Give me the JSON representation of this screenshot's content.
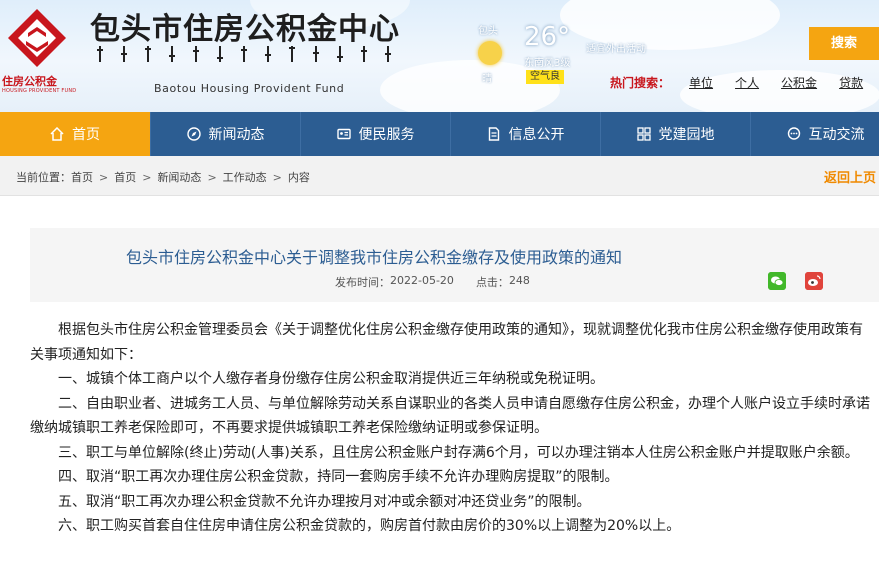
{
  "header": {
    "site_title": "包头市住房公积金中心",
    "site_title_en": "Baotou Housing Provident Fund",
    "logo_caption": "住房公积金",
    "logo_caption_en": "HOUSING PROVIDENT FUND"
  },
  "weather": {
    "city": "包头",
    "temperature": "26°",
    "condition": "晴",
    "wind": "东南风3级",
    "description": "适宜外出活动",
    "aqi": "空气良"
  },
  "search": {
    "placeholder": "",
    "button_label": "搜索",
    "hot_label": "热门搜索：",
    "hot_terms": [
      "单位",
      "个人",
      "公积金",
      "贷款"
    ]
  },
  "nav": {
    "items": [
      {
        "label": "首页",
        "icon": "home-icon"
      },
      {
        "label": "新闻动态",
        "icon": "compass-icon"
      },
      {
        "label": "便民服务",
        "icon": "id-card-icon"
      },
      {
        "label": "信息公开",
        "icon": "document-icon"
      },
      {
        "label": "党建园地",
        "icon": "grid-icon"
      },
      {
        "label": "互动交流",
        "icon": "chat-icon"
      }
    ],
    "active_color": "#f5a511",
    "bar_color": "#2c5d92"
  },
  "breadcrumb": {
    "label": "当前位置：",
    "items": [
      "首页",
      "首页",
      "新闻动态",
      "工作动态",
      "内容"
    ],
    "back_label": "返回上页"
  },
  "article": {
    "title": "包头市住房公积金中心关于调整我市住房公积金缴存及使用政策的通知",
    "date_label": "发布时间：",
    "date": "2022-05-20",
    "views_label": "点击：",
    "views": "248",
    "paragraphs": [
      "根据包头市住房公积金管理委员会《关于调整优化住房公积金缴存使用政策的通知》，现就调整优化我市住房公积金缴存使用政策有关事项通知如下：",
      "一、城镇个体工商户以个人缴存者身份缴存住房公积金取消提供近三年纳税或免税证明。",
      "二、自由职业者、进城务工人员、与单位解除劳动关系自谋职业的各类人员申请自愿缴存住房公积金，办理个人账户设立手续时承诺缴纳城镇职工养老保险即可，不再要求提供城镇职工养老保险缴纳证明或参保证明。",
      "三、职工与单位解除(终止)劳动(人事)关系，且住房公积金账户封存满6个月，可以办理注销本人住房公积金账户并提取账户余额。",
      "四、取消“职工再次办理住房公积金贷款，持同一套购房手续不允许办理购房提取”的限制。",
      "五、取消“职工再次办理公积金贷款不允许办理按月对冲或余额对冲还贷业务”的限制。",
      "六、职工购买首套自住住房申请住房公积金贷款的，购房首付款由房价的30%以上调整为20%以上。"
    ]
  }
}
